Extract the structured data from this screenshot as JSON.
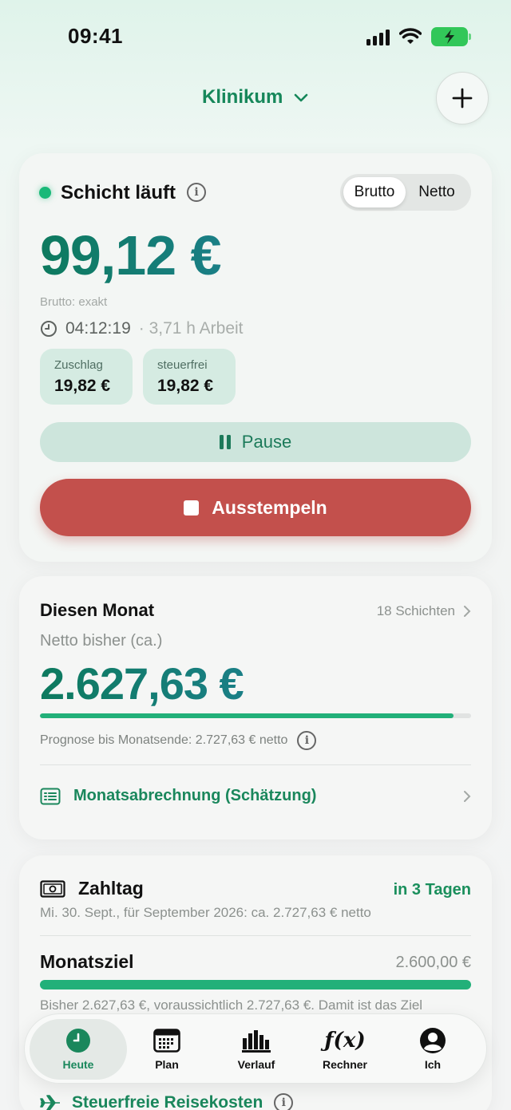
{
  "status": {
    "time": "09:41"
  },
  "header": {
    "location": "Klinikum"
  },
  "shift": {
    "title": "Schicht läuft",
    "toggle": {
      "active": "Brutto",
      "inactive": "Netto"
    },
    "amount": "99,12 €",
    "note": "Brutto: exakt",
    "elapsed": "04:12:19",
    "hours": "· 3,71 h Arbeit",
    "chips": [
      {
        "label": "Zuschlag",
        "value": "19,82 €"
      },
      {
        "label": "steuerfrei",
        "value": "19,82 €"
      }
    ],
    "pause_label": "Pause",
    "stop_label": "Ausstempeln"
  },
  "month": {
    "title": "Diesen Monat",
    "count": "18 Schichten",
    "subtitle": "Netto bisher (ca.)",
    "amount": "2.627,63 €",
    "progress": 0.96,
    "forecast": "Prognose bis Monatsende: 2.727,63 € netto",
    "link_label": "Monatsabrechnung (Schätzung)"
  },
  "payday": {
    "title": "Zahltag",
    "tag": "in 3 Tagen",
    "subtitle": "Mi. 30. Sept., für September 2026: ca. 2.727,63 € netto",
    "goal_title": "Monatsziel",
    "goal_value": "2.600,00 €",
    "goal_progress": 1.0,
    "goal_text": "Bisher 2.627,63 €, voraussichtlich 2.727,63 €. Damit ist das Ziel"
  },
  "tabs": [
    {
      "label": "Heute",
      "icon": "clock-icon",
      "active": true
    },
    {
      "label": "Plan",
      "icon": "calendar-icon",
      "active": false
    },
    {
      "label": "Verlauf",
      "icon": "bar-chart-icon",
      "active": false
    },
    {
      "label": "Rechner",
      "icon": "function-icon",
      "active": false
    },
    {
      "label": "Ich",
      "icon": "person-icon",
      "active": false
    }
  ],
  "peek": {
    "label": "Steuerfreie Reisekosten"
  },
  "colors": {
    "accent": "#1a875c",
    "stop": "#c3504c",
    "progress": "#22b079"
  }
}
